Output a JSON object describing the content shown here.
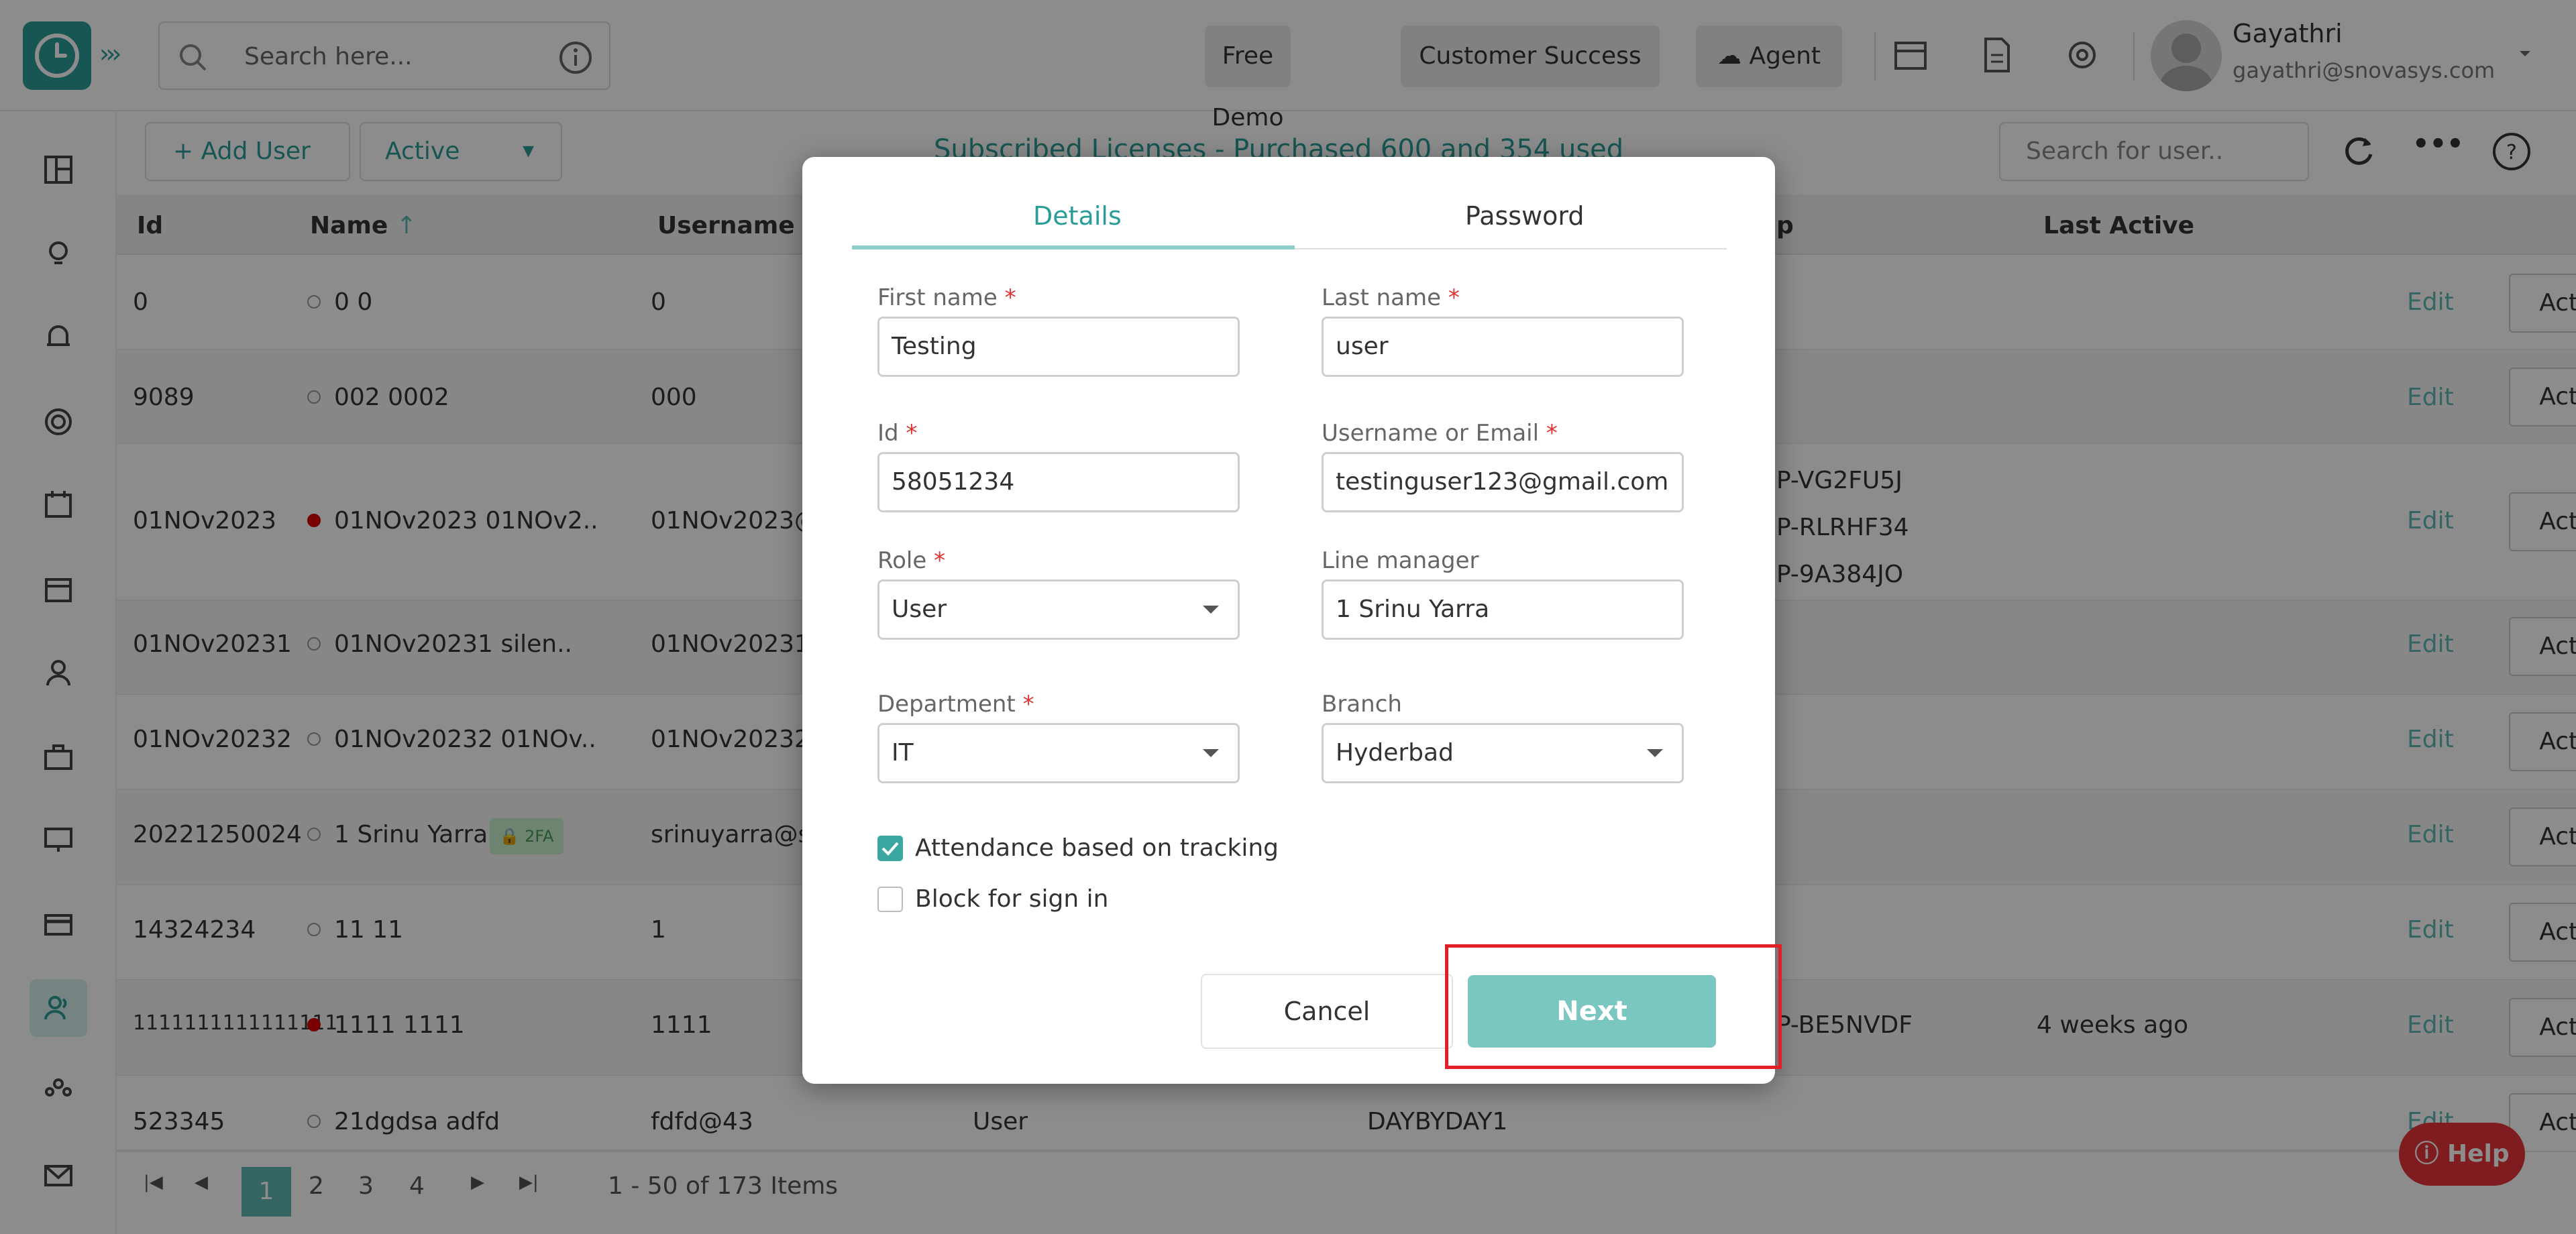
{
  "topbar": {
    "search_placeholder": "Search here...",
    "buttons": [
      "Free Demo",
      "Customer Success",
      "Agent"
    ],
    "user_name": "Gayathri",
    "user_email": "gayathri@snovasys.com"
  },
  "toolbar": {
    "add_user": "Add User",
    "status_filter": "Active",
    "licenses": "Subscribed Licenses - Purchased 600 and 354 used",
    "user_search_placeholder": "Search for user.."
  },
  "table": {
    "headers": {
      "id": "Id",
      "name": "Name",
      "username": "Username",
      "shift": "p",
      "last_active": "Last Active"
    },
    "edit_label": "Edit",
    "actions_label": "Actions",
    "rows": [
      {
        "id": "0",
        "name": "0 0",
        "username": "0",
        "status": "empty",
        "extra": "",
        "role": "",
        "shift": "",
        "last_active": ""
      },
      {
        "id": "9089",
        "name": "002 0002",
        "username": "000",
        "status": "empty",
        "extra": "",
        "role": "",
        "shift": "",
        "last_active": ""
      },
      {
        "id": "01NOv2023",
        "name": "01NOv2023 01NOv2..",
        "username": "01NOv2023@",
        "status": "red",
        "extra": "P-VG2FU5J\nP-RLRHF34\nP-9A384JO",
        "role": "",
        "shift": "",
        "last_active": ""
      },
      {
        "id": "01NOv20231",
        "name": "01NOv20231 silen..",
        "username": "01NOv20231@",
        "status": "empty",
        "extra": "",
        "role": "",
        "shift": "",
        "last_active": ""
      },
      {
        "id": "01NOv20232",
        "name": "01NOv20232 01NOv..",
        "username": "01NOv20232@",
        "status": "empty",
        "extra": "",
        "role": "",
        "shift": "",
        "last_active": ""
      },
      {
        "id": "20221250024",
        "name": "1 Srinu Yarra",
        "username": "srinuyarra@s",
        "status": "empty",
        "badge": "2FA",
        "extra": "",
        "role": "",
        "shift": "",
        "last_active": ""
      },
      {
        "id": "14324234",
        "name": "11 11",
        "username": "1",
        "status": "empty",
        "extra": "",
        "role": "",
        "shift": "",
        "last_active": ""
      },
      {
        "id": "1111111111111111",
        "name": "1111 1111",
        "username": "1111",
        "status": "red",
        "extra": "P-BE5NVDF",
        "role": "",
        "shift": "",
        "last_active": "4 weeks ago"
      },
      {
        "id": "523345",
        "name": "21dgdsa adfd",
        "username": "fdfd@43",
        "status": "empty",
        "extra": "",
        "role": "User",
        "shift": "DAYBYDAY1",
        "last_active": ""
      }
    ]
  },
  "pagination": {
    "pages": [
      "1",
      "2",
      "3",
      "4"
    ],
    "current": "1",
    "summary": "1 - 50 of 173 Items"
  },
  "modal": {
    "tabs": [
      "Details",
      "Password"
    ],
    "first_name_label": "First name",
    "first_name": "Testing",
    "last_name_label": "Last name",
    "last_name": "user",
    "id_label": "Id",
    "id_value": "58051234",
    "username_label": "Username or Email",
    "username_value": "testinguser123@gmail.com",
    "role_label": "Role",
    "role_value": "User",
    "line_manager_label": "Line manager",
    "line_manager_value": "1 Srinu Yarra",
    "department_label": "Department",
    "department_value": "IT",
    "branch_label": "Branch",
    "branch_value": "Hyderbad",
    "attendance_label": "Attendance based on tracking",
    "attendance_checked": true,
    "block_label": "Block for sign in",
    "block_checked": false,
    "cancel": "Cancel",
    "next": "Next"
  },
  "help": "Help",
  "colors": {
    "accent": "#2a9d97",
    "highlight": "#e21f26",
    "help": "#e8333a"
  }
}
